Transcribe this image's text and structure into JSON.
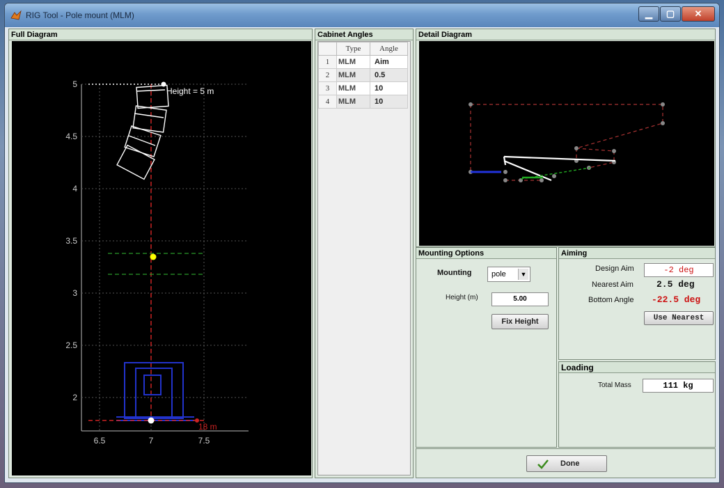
{
  "window": {
    "title": "RIG Tool - Pole mount (MLM)",
    "controls": {
      "minimize": "▁",
      "maximize": "▢",
      "close": "✕"
    }
  },
  "full_diagram": {
    "header": "Full Diagram",
    "height_label": "Height = 5 m",
    "distance_label": "18 m",
    "y_ticks": [
      "5",
      "4.5",
      "4",
      "3.5",
      "3",
      "2.5",
      "2"
    ],
    "x_ticks": [
      "6.5",
      "7",
      "7.5"
    ]
  },
  "cabinet_angles": {
    "header": "Cabinet Angles",
    "columns": [
      "Type",
      "Angle"
    ],
    "rows": [
      {
        "index": "1",
        "type": "MLM",
        "angle": "Aim"
      },
      {
        "index": "2",
        "type": "MLM",
        "angle": "0.5"
      },
      {
        "index": "3",
        "type": "MLM",
        "angle": "10"
      },
      {
        "index": "4",
        "type": "MLM",
        "angle": "10"
      }
    ]
  },
  "detail_diagram": {
    "header": "Detail Diagram"
  },
  "mounting": {
    "header": "Mounting Options",
    "mounting_label": "Mounting",
    "mounting_value": "pole",
    "height_label": "Height (m)",
    "height_value": "5.00",
    "fix_height_button": "Fix Height"
  },
  "aiming": {
    "header": "Aiming",
    "design_aim_label": "Design Aim",
    "design_aim_value": "-2 deg",
    "nearest_aim_label": "Nearest Aim",
    "nearest_aim_value": "2.5 deg",
    "bottom_angle_label": "Bottom Angle",
    "bottom_angle_value": "-22.5 deg",
    "use_nearest_button": "Use Nearest"
  },
  "loading": {
    "header": "Loading",
    "total_mass_label": "Total Mass",
    "total_mass_value": "111 kg"
  },
  "done_button": "Done",
  "colors": {
    "plot_bg": "#000000",
    "panel_bg": "#dfe9df",
    "red_value": "#cc1111"
  }
}
